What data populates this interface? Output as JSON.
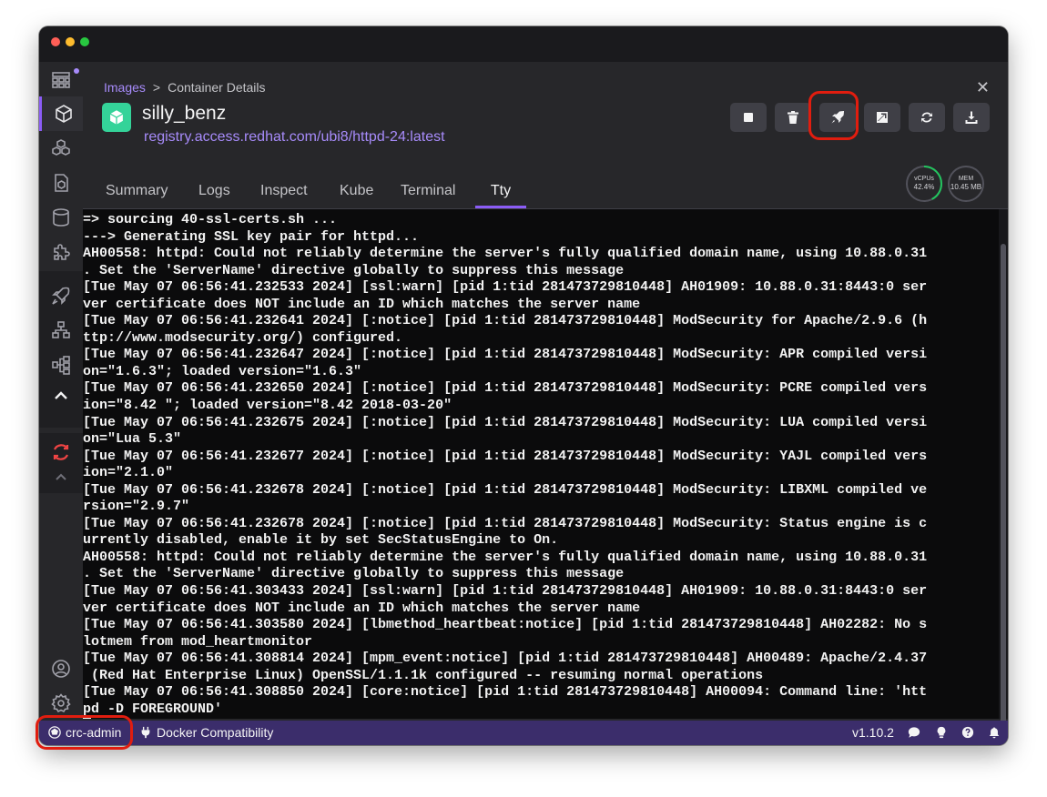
{
  "breadcrumb": {
    "parent": "Images",
    "separator": ">",
    "current": "Container Details"
  },
  "container": {
    "name": "silly_benz",
    "image": "registry.access.redhat.com/ubi8/httpd-24:latest"
  },
  "tabs": [
    {
      "label": "Summary"
    },
    {
      "label": "Logs"
    },
    {
      "label": "Inspect"
    },
    {
      "label": "Kube"
    },
    {
      "label": "Terminal"
    },
    {
      "label": "Tty",
      "active": true
    }
  ],
  "stats": {
    "cpu": {
      "label": "vCPUs",
      "value": "42.4%",
      "fraction": 0.424
    },
    "mem": {
      "label": "MEM",
      "value": "10.45 MB"
    }
  },
  "actions": [
    "stop",
    "delete",
    "deploy-to-kubernetes",
    "open-browser",
    "restart",
    "export"
  ],
  "terminal_lines": [
    "=> sourcing 40-ssl-certs.sh ...",
    "---> Generating SSL key pair for httpd...",
    "AH00558: httpd: Could not reliably determine the server's fully qualified domain name, using 10.88.0.31",
    ". Set the 'ServerName' directive globally to suppress this message",
    "[Tue May 07 06:56:41.232533 2024] [ssl:warn] [pid 1:tid 281473729810448] AH01909: 10.88.0.31:8443:0 ser",
    "ver certificate does NOT include an ID which matches the server name",
    "[Tue May 07 06:56:41.232641 2024] [:notice] [pid 1:tid 281473729810448] ModSecurity for Apache/2.9.6 (h",
    "ttp://www.modsecurity.org/) configured.",
    "[Tue May 07 06:56:41.232647 2024] [:notice] [pid 1:tid 281473729810448] ModSecurity: APR compiled versi",
    "on=\"1.6.3\"; loaded version=\"1.6.3\"",
    "[Tue May 07 06:56:41.232650 2024] [:notice] [pid 1:tid 281473729810448] ModSecurity: PCRE compiled vers",
    "ion=\"8.42 \"; loaded version=\"8.42 2018-03-20\"",
    "[Tue May 07 06:56:41.232675 2024] [:notice] [pid 1:tid 281473729810448] ModSecurity: LUA compiled versi",
    "on=\"Lua 5.3\"",
    "[Tue May 07 06:56:41.232677 2024] [:notice] [pid 1:tid 281473729810448] ModSecurity: YAJL compiled vers",
    "ion=\"2.1.0\"",
    "[Tue May 07 06:56:41.232678 2024] [:notice] [pid 1:tid 281473729810448] ModSecurity: LIBXML compiled ve",
    "rsion=\"2.9.7\"",
    "[Tue May 07 06:56:41.232678 2024] [:notice] [pid 1:tid 281473729810448] ModSecurity: Status engine is c",
    "urrently disabled, enable it by set SecStatusEngine to On.",
    "AH00558: httpd: Could not reliably determine the server's fully qualified domain name, using 10.88.0.31",
    ". Set the 'ServerName' directive globally to suppress this message",
    "[Tue May 07 06:56:41.303433 2024] [ssl:warn] [pid 1:tid 281473729810448] AH01909: 10.88.0.31:8443:0 ser",
    "ver certificate does NOT include an ID which matches the server name",
    "[Tue May 07 06:56:41.303580 2024] [lbmethod_heartbeat:notice] [pid 1:tid 281473729810448] AH02282: No s",
    "lotmem from mod_heartmonitor",
    "[Tue May 07 06:56:41.308814 2024] [mpm_event:notice] [pid 1:tid 281473729810448] AH00489: Apache/2.4.37",
    " (Red Hat Enterprise Linux) OpenSSL/1.1.1k configured -- resuming normal operations",
    "[Tue May 07 06:56:41.308850 2024] [core:notice] [pid 1:tid 281473729810448] AH00094: Command line: 'htt",
    "pd -D FOREGROUND'"
  ],
  "statusbar": {
    "context": "crc-admin",
    "docker": "Docker Compatibility",
    "version": "v1.10.2"
  },
  "colors": {
    "accent": "#8b5cf6",
    "link": "#a78bfa",
    "highlight": "#e11d0f",
    "statusbar": "#3b2d6b",
    "container_icon": "#34d399"
  }
}
